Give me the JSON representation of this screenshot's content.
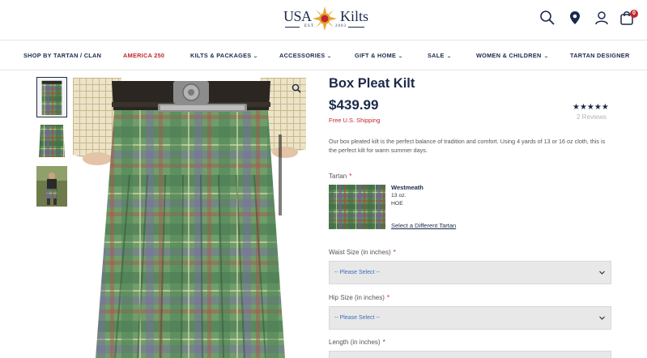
{
  "logo": {
    "left": "USA",
    "right": "Kilts",
    "est": "EST.",
    "year": "2003"
  },
  "header_icons": [
    "search-icon",
    "location-pin-icon",
    "user-icon",
    "shopping-bag-icon"
  ],
  "cart_count": "0",
  "nav": [
    {
      "label": "SHOP BY TARTAN / CLAN",
      "dropdown": false
    },
    {
      "label": "AMERICA 250",
      "dropdown": false,
      "color": "#c0272d"
    },
    {
      "label": "KILTS & PACKAGES",
      "dropdown": true
    },
    {
      "label": "ACCESSORIES",
      "dropdown": true
    },
    {
      "label": "GIFT & HOME",
      "dropdown": true
    },
    {
      "label": "SALE",
      "dropdown": true
    },
    {
      "label": "WOMEN & CHILDREN",
      "dropdown": true
    },
    {
      "label": "TARTAN DESIGNER",
      "dropdown": false
    }
  ],
  "product": {
    "title": "Box Pleat Kilt",
    "price": "$439.99",
    "shipping": "Free U.S. Shipping",
    "stars": "★★★★★",
    "rating": 5,
    "reviews": "2 Reviews",
    "description": "Our box pleated kilt is the perfect balance of tradition and comfort.  Using 4 yards of 13 or 16 oz cloth, this is the perfect kilt for warm summer days."
  },
  "tartan": {
    "label": "Tartan",
    "required": "*",
    "name": "Westmeath",
    "weight": "13 oz.",
    "code": "HOE",
    "change_link": "Select a Different Tartan"
  },
  "fields": {
    "waist": {
      "label": "Waist Size (in inches)",
      "required": "*",
      "value": "-- Please Select --"
    },
    "hip": {
      "label": "Hip Size (in inches)",
      "required": "*",
      "value": "-- Please Select --"
    },
    "length": {
      "label": "Length (in inches)",
      "required": "*"
    }
  },
  "colors": {
    "navy": "#1b2a4a",
    "accent_red": "#c0272d",
    "link_blue": "#3b6fb6"
  }
}
